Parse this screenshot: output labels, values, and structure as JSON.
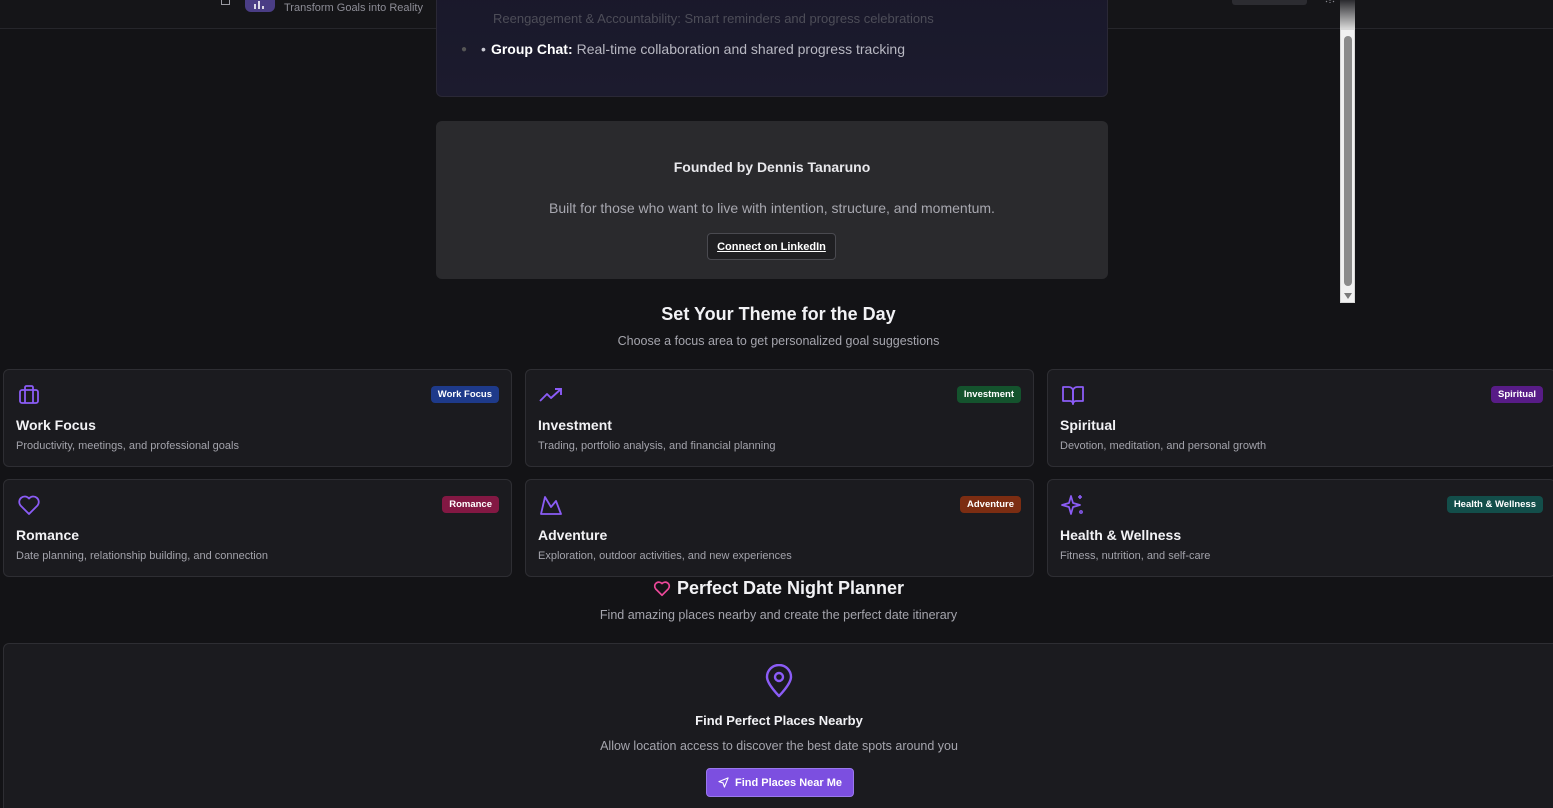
{
  "header": {
    "tagline": "Transform Goals into Reality",
    "logo_icon": "bar-chart-icon",
    "theme_toggle_icon": "sun-icon"
  },
  "features": {
    "faded_line": "Reengagement & Accountability: Smart reminders and progress celebrations",
    "group_chat_label": "Group Chat:",
    "group_chat_text": "Real-time collaboration and shared progress tracking"
  },
  "founder": {
    "title": "Founded by Dennis Tanaruno",
    "subtitle": "Built for those who want to live with intention, structure, and momentum.",
    "linkedin_label": "Connect on LinkedIn"
  },
  "themes": {
    "title": "Set Your Theme for the Day",
    "subtitle": "Choose a focus area to get personalized goal suggestions",
    "cards": [
      {
        "name": "Work Focus",
        "desc": "Productivity, meetings, and professional goals",
        "badge": "Work Focus",
        "badge_color": "#1e3a8a",
        "icon": "briefcase-icon"
      },
      {
        "name": "Investment",
        "desc": "Trading, portfolio analysis, and financial planning",
        "badge": "Investment",
        "badge_color": "#14532d",
        "icon": "trending-up-icon"
      },
      {
        "name": "Spiritual",
        "desc": "Devotion, meditation, and personal growth",
        "badge": "Spiritual",
        "badge_color": "#581c87",
        "icon": "book-open-icon"
      },
      {
        "name": "Romance",
        "desc": "Date planning, relationship building, and connection",
        "badge": "Romance",
        "badge_color": "#831843",
        "icon": "heart-icon"
      },
      {
        "name": "Adventure",
        "desc": "Exploration, outdoor activities, and new experiences",
        "badge": "Adventure",
        "badge_color": "#7c2d12",
        "icon": "mountain-icon"
      },
      {
        "name": "Health & Wellness",
        "desc": "Fitness, nutrition, and self-care",
        "badge": "Health & Wellness",
        "badge_color": "#134e4a",
        "icon": "sparkles-icon"
      }
    ]
  },
  "date_planner": {
    "title": "Perfect Date Night Planner",
    "subtitle": "Find amazing places nearby and create the perfect date itinerary",
    "card_title": "Find Perfect Places Nearby",
    "card_subtitle": "Allow location access to discover the best date spots around you",
    "button_label": "Find Places Near Me"
  },
  "colors": {
    "accent": "#7c4fe0",
    "icon_purple": "#8b5cf6",
    "heart_pink": "#ec4899",
    "background": "#131316"
  }
}
